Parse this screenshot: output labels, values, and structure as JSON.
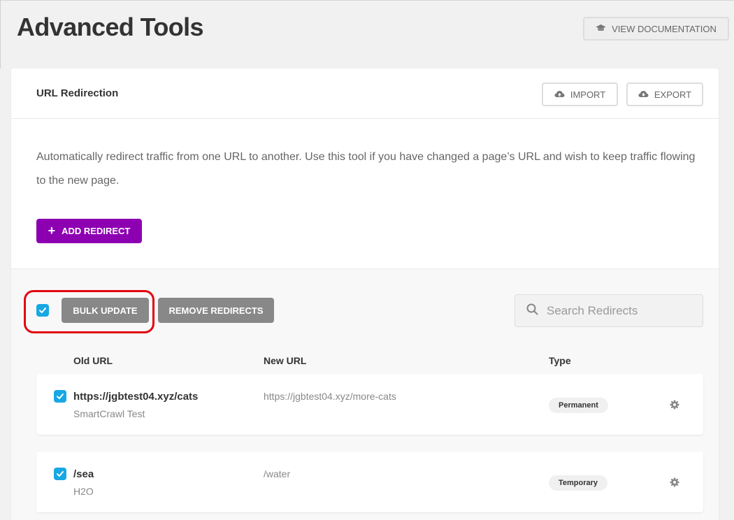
{
  "page": {
    "title": "Advanced Tools",
    "view_docs_label": "VIEW DOCUMENTATION"
  },
  "card": {
    "title": "URL Redirection",
    "import_label": "IMPORT",
    "export_label": "EXPORT",
    "description": "Automatically redirect traffic from one URL to another. Use this tool if you have changed a page’s URL and wish to keep traffic flowing to the new page.",
    "add_label": "ADD REDIRECT"
  },
  "toolbar": {
    "select_all_checked": true,
    "bulk_update_label": "BULK UPDATE",
    "remove_label": "REMOVE REDIRECTS",
    "search_placeholder": "Search Redirects",
    "search_value": ""
  },
  "table": {
    "columns": [
      "Old URL",
      "New URL",
      "Type"
    ],
    "rows": [
      {
        "checked": true,
        "old_url": "https://jgbtest04.xyz/cats",
        "title": "SmartCrawl Test",
        "new_url": "https://jgbtest04.xyz/more-cats",
        "type": "Permanent"
      },
      {
        "checked": true,
        "old_url": "/sea",
        "title": "H2O",
        "new_url": "/water",
        "type": "Temporary"
      }
    ]
  },
  "colors": {
    "accent_purple": "#8d00b1",
    "checkbox_blue": "#17a8e3",
    "highlight_red": "#e2040f",
    "gray_button": "#888888"
  },
  "icons": {
    "docs": "graduation-cap-icon",
    "import": "cloud-upload-icon",
    "export": "cloud-download-icon",
    "add": "plus-icon",
    "search": "search-icon",
    "row_settings": "gear-icon",
    "checkbox": "checkmark-icon"
  }
}
